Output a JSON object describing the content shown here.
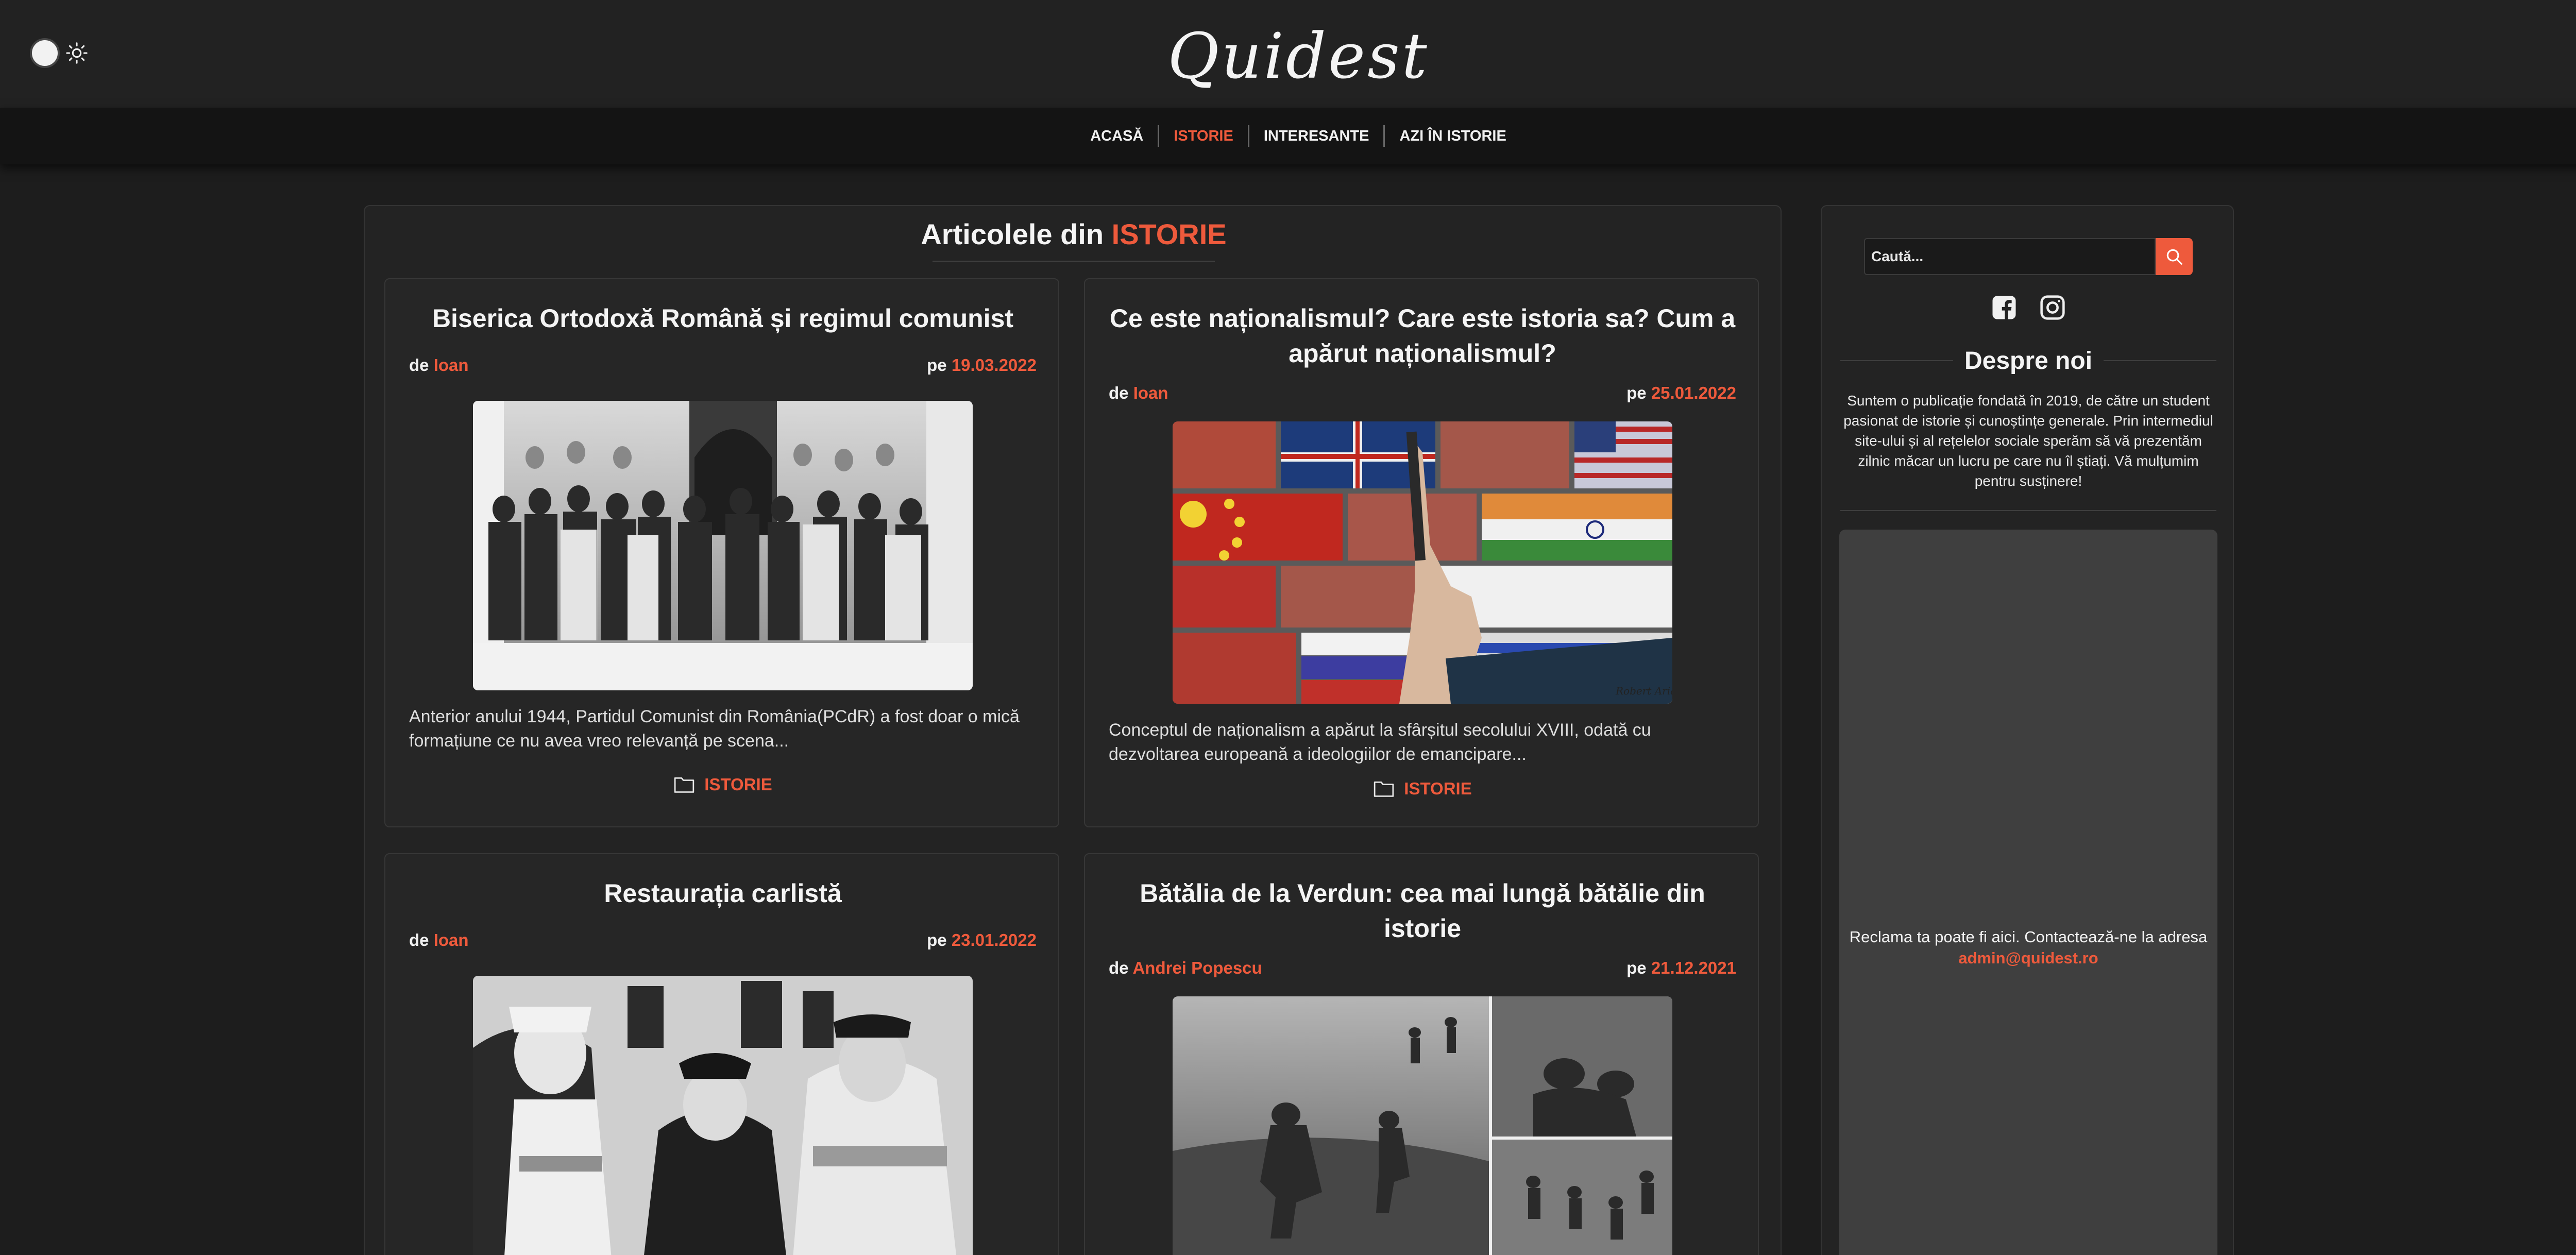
{
  "site": {
    "brand": "Quidest",
    "theme_toggle_icon": "sun-icon"
  },
  "nav": {
    "items": [
      {
        "label": "ACASĂ",
        "active": false
      },
      {
        "label": "ISTORIE",
        "active": true
      },
      {
        "label": "INTERESANTE",
        "active": false
      },
      {
        "label": "AZI ÎN ISTORIE",
        "active": false
      }
    ]
  },
  "main": {
    "heading_prefix": "Articolele din",
    "heading_category": "ISTORIE",
    "articles": [
      {
        "title": "Biserica Ortodoxă Română și regimul comunist",
        "by_label": "de",
        "author": "Ioan",
        "date_label": "pe",
        "date": "19.03.2022",
        "excerpt": "Anterior anului 1944, Partidul Comunist din România(PCdR) a fost doar o mică formațiune ce nu avea vreo relevanță pe scena...",
        "category": "ISTORIE"
      },
      {
        "title": "Ce este naționalismul? Care este istoria sa? Cum a apărut naționalismul?",
        "by_label": "de",
        "author": "Ioan",
        "date_label": "pe",
        "date": "25.01.2022",
        "excerpt": "Conceptul de naționalism a apărut la sfârșitul secolului XVIII, odată cu dezvoltarea europeană a ideologiilor de emancipare...",
        "category": "ISTORIE",
        "image_signature": "Robert Ariail"
      },
      {
        "title": "Restaurația carlistă",
        "by_label": "de",
        "author": "Ioan",
        "date_label": "pe",
        "date": "23.01.2022"
      },
      {
        "title": "Bătălia de la Verdun: cea mai lungă bătălie din istorie",
        "by_label": "de",
        "author": "Andrei Popescu",
        "date_label": "pe",
        "date": "21.12.2021"
      }
    ]
  },
  "sidebar": {
    "search_placeholder": "Caută...",
    "social_icons": [
      "facebook-icon",
      "instagram-icon"
    ],
    "about_heading": "Despre noi",
    "about_text": "Suntem o publicație fondată în 2019, de către un student pasionat de istorie și cunoștințe generale. Prin intermediul site-ului și al rețelelor sociale sperăm să vă prezentăm zilnic măcar un lucru pe care nu îl știați. Vă mulțumim pentru susținere!",
    "ad_text": "Reclama ta poate fi aici. Contactează-ne la adresa",
    "ad_email": "admin@quidest.ro"
  },
  "colors": {
    "accent": "#ee5a3c",
    "background": "#1d1d1d",
    "header": "#222222",
    "navbar": "#141414",
    "panel": "#232323",
    "ad_box": "#3f3f3f"
  }
}
